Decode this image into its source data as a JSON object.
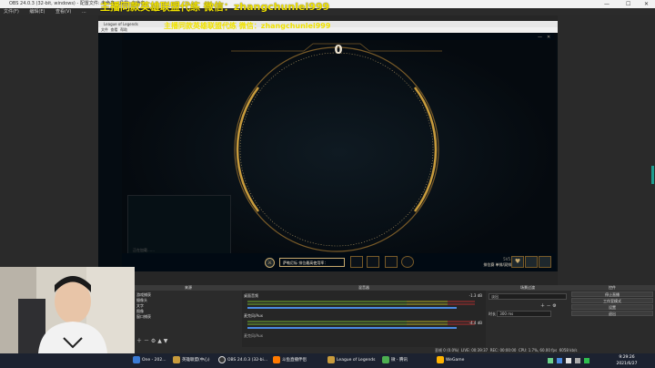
{
  "obs_window": {
    "title": "OBS 24.0.3 (32-bit, windows) - 配置文件: 未命名 - 场景: 未命名",
    "menu": [
      "文件(F)",
      "编辑(E)",
      "查看(V)",
      "..."
    ],
    "overlay_caption": "主播同款英雄联盟代练",
    "overlay_contact": "微信：zhangchunlei999"
  },
  "game_window": {
    "title": "League of Legends",
    "menu": [
      "文件",
      "查看",
      "帮助"
    ],
    "overlay_caption": "主播同款英雄联盟代练  微信：zhangchunlei999"
  },
  "lol_client": {
    "timer": "0",
    "chat_placeholder": "正在加载……",
    "queue_button": "萨勒尼标 排位最高使用率：",
    "mode_title": "5V5",
    "mode_subtitle": "排位赛 单排/双排"
  },
  "obs_docks": {
    "sources_title": "来源",
    "sources": [
      "游戏捕获",
      "摄像头",
      "文字",
      "图像",
      "窗口捕获"
    ],
    "mixer_title": "混音器",
    "mixer_channels": [
      {
        "name": "桌面音频",
        "db": "-1.3 dB"
      },
      {
        "name": "麦克风/Aux",
        "db": "-4.4 dB"
      }
    ],
    "mixer_footer": "麦克风/Aux",
    "transition_title": "场景过渡",
    "transition_value": "淡出",
    "duration_label": "时长",
    "duration_value": "300 ms",
    "controls_title": "控件",
    "controls": [
      "停止直播",
      "工作室模式",
      "设置",
      "退出"
    ]
  },
  "status_bar": {
    "dropped": "丢帧 0 (0.0%)",
    "live": "LIVE: 00:39:37",
    "rec": "REC: 00:00:00",
    "cpu": "CPU: 1.7%, 60.00 fps",
    "kbps": "6058 kb/s"
  },
  "taskbar": {
    "items": [
      {
        "label": "One - 202...",
        "color": "#3a7bd5"
      },
      {
        "label": "英雄联盟(中心)",
        "color": "#c89b3c"
      },
      {
        "label": "OBS 24.0.3 (32-bi...",
        "color": "#333333"
      },
      {
        "label": "斗鱼直播伴侣",
        "color": "#ff7a00"
      },
      {
        "label": "League of Legends",
        "color": "#c89b3c"
      },
      {
        "label": "微 - 腾讯",
        "color": "#4caf50"
      },
      {
        "label": "WeGame",
        "color": "#ffb300"
      }
    ],
    "time": "9:29:26",
    "date": "2021/6/27"
  }
}
